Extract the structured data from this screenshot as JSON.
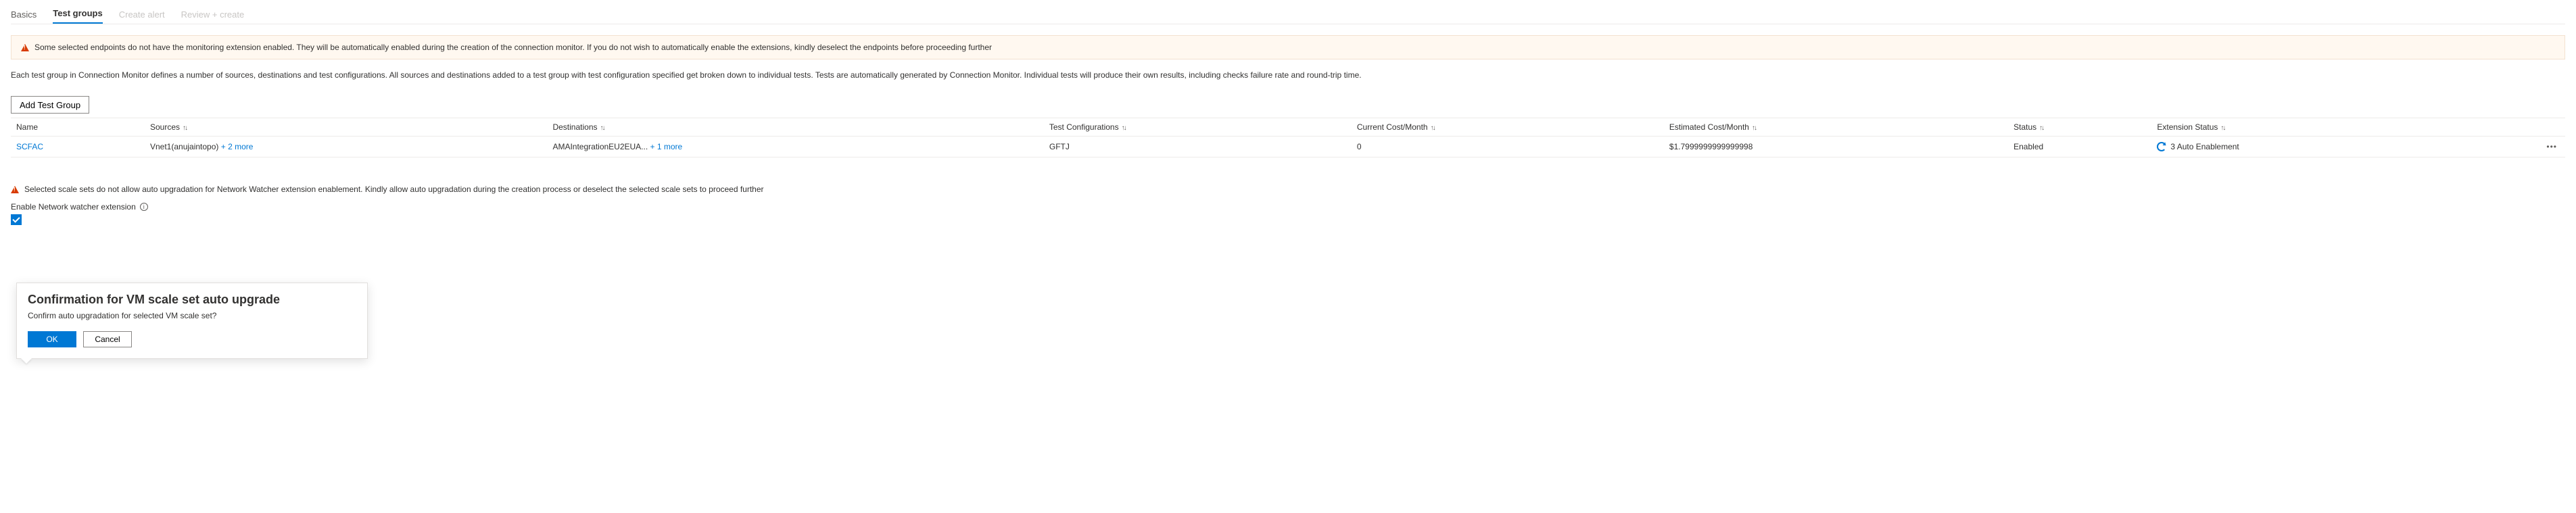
{
  "tabs": {
    "basics": "Basics",
    "test_groups": "Test groups",
    "create_alert": "Create alert",
    "review_create": "Review + create"
  },
  "banner": {
    "text": "Some selected endpoints do not have the monitoring extension enabled. They will be automatically enabled during the creation of the connection monitor. If you do not wish to automatically enable the extensions, kindly deselect the endpoints before proceeding further"
  },
  "intro": "Each test group in Connection Monitor defines a number of sources, destinations and test configurations. All sources and destinations added to a test group with test configuration specified get broken down to individual tests. Tests are automatically generated by Connection Monitor. Individual tests will produce their own results, including checks failure rate and round-trip time.",
  "add_button": "Add Test Group",
  "columns": {
    "name": "Name",
    "sources": "Sources",
    "destinations": "Destinations",
    "test_configs": "Test Configurations",
    "current_cost": "Current Cost/Month",
    "estimated_cost": "Estimated Cost/Month",
    "status": "Status",
    "extension_status": "Extension Status"
  },
  "sort_arrows": "↑↓",
  "rows": [
    {
      "name": "SCFAC",
      "sources_main": "Vnet1(anujaintopo)",
      "sources_more": "+ 2 more",
      "dest_main": "AMAIntegrationEU2EUA...",
      "dest_more": "+ 1 more",
      "test_configs": "GFTJ",
      "current_cost": "0",
      "estimated_cost": "$1.7999999999999998",
      "status": "Enabled",
      "extension_status": "3 Auto Enablement"
    }
  ],
  "vmss_warning": "Selected scale sets do not allow auto upgradation for Network Watcher extension enablement. Kindly allow auto upgradation during the creation process or deselect the selected scale sets to proceed further",
  "enable_ext_label": "Enable Network watcher extension",
  "callout": {
    "title": "Confirmation for VM scale set auto upgrade",
    "body": "Confirm auto upgradation for selected VM scale set?",
    "ok": "OK",
    "cancel": "Cancel"
  }
}
